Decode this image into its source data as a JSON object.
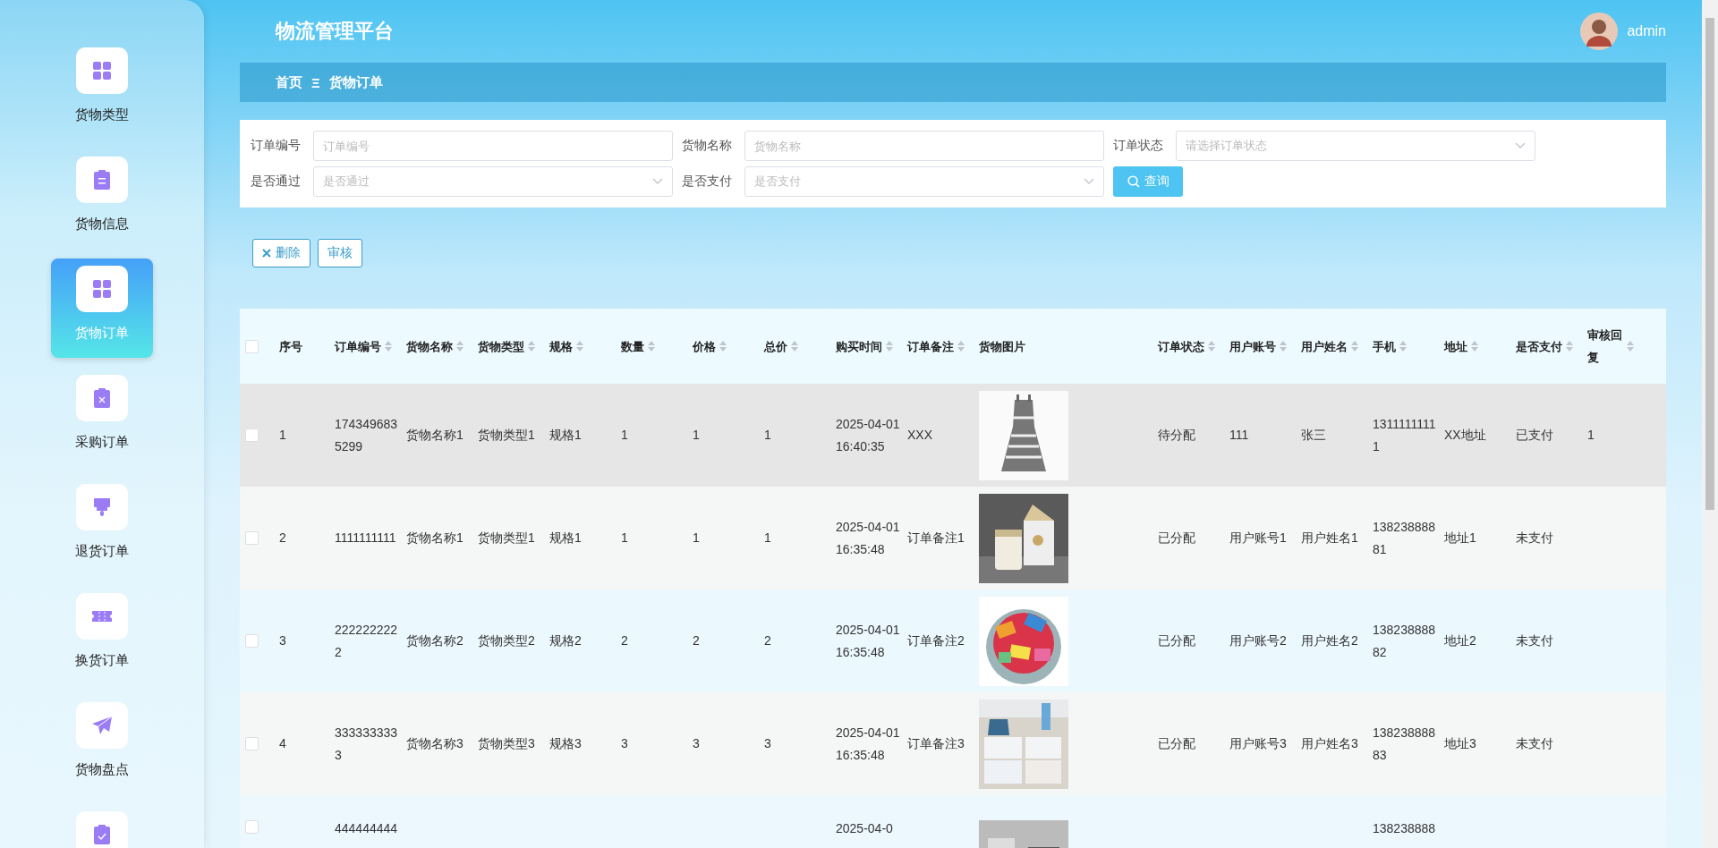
{
  "app": {
    "title": "物流管理平台"
  },
  "user": {
    "name": "admin"
  },
  "sidebar": {
    "items": [
      {
        "label": "货物类型",
        "selected": false
      },
      {
        "label": "货物信息",
        "selected": false
      },
      {
        "label": "货物订单",
        "selected": true
      },
      {
        "label": "采购订单",
        "selected": false
      },
      {
        "label": "退货订单",
        "selected": false
      },
      {
        "label": "换货订单",
        "selected": false
      },
      {
        "label": "货物盘点",
        "selected": false
      },
      {
        "selected": false
      }
    ]
  },
  "breadcrumb": {
    "home": "首页",
    "separator": "Ξ",
    "current": "货物订单"
  },
  "filters": [
    {
      "label": "订单编号",
      "kind": "input",
      "placeholder": "订单编号"
    },
    {
      "label": "货物名称",
      "kind": "input",
      "placeholder": "货物名称"
    },
    {
      "label": "订单状态",
      "kind": "select",
      "placeholder": "请选择订单状态"
    },
    {
      "label": "是否通过",
      "kind": "select",
      "placeholder": "是否通过"
    },
    {
      "label": "是否支付",
      "kind": "select",
      "placeholder": "是否支付"
    }
  ],
  "search_button": "查询",
  "actions": [
    {
      "label": "删除",
      "kind": "delete"
    },
    {
      "label": "审核",
      "kind": "plain"
    }
  ],
  "table": {
    "all_checked": false,
    "columns": [
      {
        "label": "序号",
        "kind": "text",
        "sortable": false
      },
      {
        "label": "订单编号",
        "kind": "text",
        "sortable": true
      },
      {
        "label": "货物名称",
        "kind": "text",
        "sortable": true
      },
      {
        "label": "货物类型",
        "kind": "text",
        "sortable": true
      },
      {
        "label": "规格",
        "kind": "text",
        "sortable": true
      },
      {
        "label": "数量",
        "kind": "text",
        "sortable": true
      },
      {
        "label": "价格",
        "kind": "text",
        "sortable": true
      },
      {
        "label": "总价",
        "kind": "text",
        "sortable": true
      },
      {
        "label": "购买时间",
        "kind": "text",
        "sortable": true
      },
      {
        "label": "订单备注",
        "kind": "text",
        "sortable": true
      },
      {
        "label": "货物图片",
        "kind": "picture",
        "sortable": false
      },
      {
        "label": "订单状态",
        "kind": "text",
        "sortable": true
      },
      {
        "label": "用户账号",
        "kind": "text",
        "sortable": true
      },
      {
        "label": "用户姓名",
        "kind": "text",
        "sortable": true
      },
      {
        "label": "手机",
        "kind": "text",
        "sortable": true
      },
      {
        "label": "地址",
        "kind": "text",
        "sortable": true
      },
      {
        "label": "是否支付",
        "kind": "text",
        "sortable": true
      },
      {
        "label": "审核回复",
        "kind": "text",
        "sortable": true
      }
    ],
    "rows": [
      {
        "checked": false,
        "hovered": true,
        "cells": [
          "1",
          "1743496835299",
          "货物名称1",
          "货物类型1",
          "规格1",
          "1",
          "1",
          "1",
          "2025-04-01 16:40:35",
          "XXX",
          "",
          "待分配",
          "111",
          "张三",
          "13111111111",
          "XX地址",
          "已支付",
          "1"
        ]
      },
      {
        "checked": false,
        "hovered": false,
        "cells": [
          "2",
          "1111111111",
          "货物名称1",
          "货物类型1",
          "规格1",
          "1",
          "1",
          "1",
          "2025-04-01 16:35:48",
          "订单备注1",
          "",
          "已分配",
          "用户账号1",
          "用户姓名1",
          "13823888881",
          "地址1",
          "未支付"
        ]
      },
      {
        "checked": false,
        "hovered": false,
        "cells": [
          "3",
          "2222222222",
          "货物名称2",
          "货物类型2",
          "规格2",
          "2",
          "2",
          "2",
          "2025-04-01 16:35:48",
          "订单备注2",
          "",
          "已分配",
          "用户账号2",
          "用户姓名2",
          "13823888882",
          "地址2",
          "未支付"
        ]
      },
      {
        "checked": false,
        "hovered": false,
        "cells": [
          "4",
          "3333333333",
          "货物名称3",
          "货物类型3",
          "规格3",
          "3",
          "3",
          "3",
          "2025-04-01 16:35:48",
          "订单备注3",
          "",
          "已分配",
          "用户账号3",
          "用户姓名3",
          "13823888883",
          "地址3",
          "未支付"
        ]
      },
      {
        "checked": false,
        "hovered": false,
        "cells": [
          "",
          "444444444",
          "",
          "",
          "",
          "",
          "",
          "",
          "2025-04-0",
          "",
          "",
          "",
          "",
          "",
          "138238888"
        ]
      }
    ]
  }
}
